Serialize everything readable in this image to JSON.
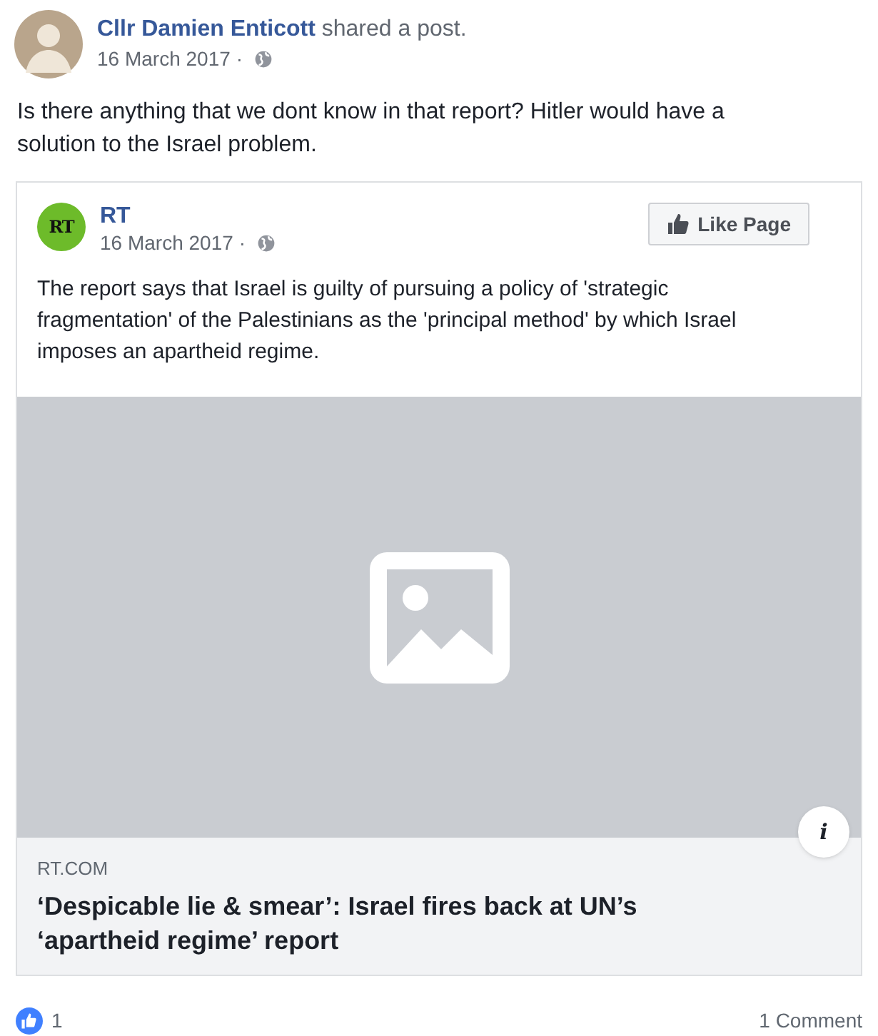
{
  "post": {
    "author": "Cllr Damien Enticott",
    "action": "shared a post.",
    "date": "16 March 2017",
    "separator": "·",
    "message": "Is there anything that we dont know in that report? Hitler would have a solution to the Israel problem."
  },
  "shared": {
    "page": "RT",
    "logo_text": "RT",
    "date": "16 March 2017",
    "separator": "·",
    "like_button": "Like Page",
    "message": "The report says that Israel is guilty of pursuing a policy of 'strategic fragmentation' of the Palestinians as the 'principal method' by which Israel imposes an apartheid regime.",
    "image": {
      "kind": "placeholder"
    },
    "info_button": "i",
    "link": {
      "domain": "RT.COM",
      "title": "‘Despicable lie & smear’: Israel fires back at UN’s ‘apartheid regime’ report"
    }
  },
  "footer": {
    "likes": "1",
    "comments": "1 Comment"
  }
}
